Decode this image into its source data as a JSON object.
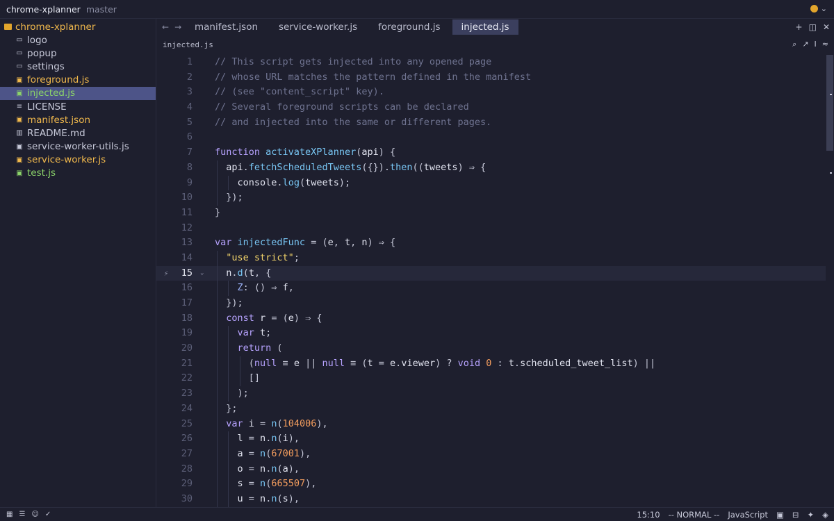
{
  "titlebar": {
    "project": "chrome-xplanner",
    "branch": "master"
  },
  "sidebar": {
    "root": "chrome-xplanner",
    "items": [
      {
        "label": "logo",
        "icon": "folder-icon",
        "glyph": "▭",
        "color": "#c6c8d8"
      },
      {
        "label": "popup",
        "icon": "folder-icon",
        "glyph": "▭",
        "color": "#c6c8d8"
      },
      {
        "label": "settings",
        "icon": "folder-icon",
        "glyph": "▭",
        "color": "#c6c8d8"
      },
      {
        "label": "foreground.js",
        "icon": "js-file-icon",
        "glyph": "▣",
        "color": "#f0b84c"
      },
      {
        "label": "injected.js",
        "icon": "js-file-icon",
        "glyph": "▣",
        "color": "#8bd36a",
        "active": true
      },
      {
        "label": "LICENSE",
        "icon": "text-file-icon",
        "glyph": "≡",
        "color": "#c6c8d8"
      },
      {
        "label": "manifest.json",
        "icon": "json-file-icon",
        "glyph": "▣",
        "color": "#f0b84c"
      },
      {
        "label": "README.md",
        "icon": "markdown-file-icon",
        "glyph": "▥",
        "color": "#c6c8d8"
      },
      {
        "label": "service-worker-utils.js",
        "icon": "js-file-icon",
        "glyph": "▣",
        "color": "#c6c8d8"
      },
      {
        "label": "service-worker.js",
        "icon": "js-file-icon",
        "glyph": "▣",
        "color": "#f0b84c"
      },
      {
        "label": "test.js",
        "icon": "js-file-icon",
        "glyph": "▣",
        "color": "#8bd36a"
      }
    ]
  },
  "tabs": [
    {
      "label": "manifest.json",
      "active": false
    },
    {
      "label": "service-worker.js",
      "active": false
    },
    {
      "label": "foreground.js",
      "active": false
    },
    {
      "label": "injected.js",
      "active": true
    }
  ],
  "breadcrumb": "injected.js",
  "editor": {
    "current_line": 15,
    "lines": [
      [
        [
          "// This script gets injected into any opened page",
          "com"
        ]
      ],
      [
        [
          "// whose URL matches the pattern defined in the manifest",
          "com"
        ]
      ],
      [
        [
          "// (see \"content_script\" key).",
          "com"
        ]
      ],
      [
        [
          "// Several foreground scripts can be declared",
          "com"
        ]
      ],
      [
        [
          "// and injected into the same or different pages.",
          "com"
        ]
      ],
      [],
      [
        [
          "function ",
          "kw"
        ],
        [
          "activateXPlanner",
          "fn"
        ],
        [
          "(",
          "pun"
        ],
        [
          "api",
          "var"
        ],
        [
          ") {",
          "pun"
        ]
      ],
      [
        [
          "  ",
          "pun"
        ],
        [
          "api",
          "var"
        ],
        [
          ".",
          "pun"
        ],
        [
          "fetchScheduledTweets",
          "fn"
        ],
        [
          "({}).",
          "pun"
        ],
        [
          "then",
          "fn"
        ],
        [
          "((",
          "pun"
        ],
        [
          "tweets",
          "var"
        ],
        [
          ") ⇒ {",
          "pun"
        ]
      ],
      [
        [
          "    ",
          "pun"
        ],
        [
          "console",
          "var"
        ],
        [
          ".",
          "pun"
        ],
        [
          "log",
          "fn"
        ],
        [
          "(",
          "pun"
        ],
        [
          "tweets",
          "var"
        ],
        [
          ");",
          "pun"
        ]
      ],
      [
        [
          "  });",
          "pun"
        ]
      ],
      [
        [
          "}",
          "pun"
        ]
      ],
      [],
      [
        [
          "var ",
          "kw"
        ],
        [
          "injectedFunc",
          "fn"
        ],
        [
          " = (",
          "pun"
        ],
        [
          "e",
          "var"
        ],
        [
          ", ",
          "pun"
        ],
        [
          "t",
          "var"
        ],
        [
          ", ",
          "pun"
        ],
        [
          "n",
          "var"
        ],
        [
          ") ⇒ {",
          "pun"
        ]
      ],
      [
        [
          "  ",
          "pun"
        ],
        [
          "\"use strict\"",
          "str"
        ],
        [
          ";",
          "pun"
        ]
      ],
      [
        [
          "  ",
          "pun"
        ],
        [
          "n",
          "var"
        ],
        [
          ".",
          "pun"
        ],
        [
          "d",
          "fn"
        ],
        [
          "(",
          "pun"
        ],
        [
          "t",
          "var"
        ],
        [
          ", {",
          "pun"
        ]
      ],
      [
        [
          "    ",
          "pun"
        ],
        [
          "Z",
          "prop"
        ],
        [
          ": () ⇒ ",
          "pun"
        ],
        [
          "f",
          "var"
        ],
        [
          ",",
          "pun"
        ]
      ],
      [
        [
          "  });",
          "pun"
        ]
      ],
      [
        [
          "  ",
          "pun"
        ],
        [
          "const ",
          "kw"
        ],
        [
          "r",
          "var"
        ],
        [
          " = (",
          "pun"
        ],
        [
          "e",
          "var"
        ],
        [
          ") ⇒ {",
          "pun"
        ]
      ],
      [
        [
          "    ",
          "pun"
        ],
        [
          "var ",
          "kw"
        ],
        [
          "t",
          "var"
        ],
        [
          ";",
          "pun"
        ]
      ],
      [
        [
          "    ",
          "pun"
        ],
        [
          "return ",
          "kw"
        ],
        [
          "(",
          "pun"
        ]
      ],
      [
        [
          "      (",
          "pun"
        ],
        [
          "null",
          "kw"
        ],
        [
          " ≡ ",
          "pun"
        ],
        [
          "e",
          "var"
        ],
        [
          " || ",
          "pun"
        ],
        [
          "null",
          "kw"
        ],
        [
          " ≡ (",
          "pun"
        ],
        [
          "t",
          "var"
        ],
        [
          " = ",
          "pun"
        ],
        [
          "e",
          "var"
        ],
        [
          ".",
          "pun"
        ],
        [
          "viewer",
          "var"
        ],
        [
          ") ? ",
          "pun"
        ],
        [
          "void ",
          "kw"
        ],
        [
          "0",
          "num"
        ],
        [
          " : ",
          "pun"
        ],
        [
          "t",
          "var"
        ],
        [
          ".",
          "pun"
        ],
        [
          "scheduled_tweet_list",
          "var"
        ],
        [
          ") ||",
          "pun"
        ]
      ],
      [
        [
          "      []",
          "pun"
        ]
      ],
      [
        [
          "    );",
          "pun"
        ]
      ],
      [
        [
          "  };",
          "pun"
        ]
      ],
      [
        [
          "  ",
          "pun"
        ],
        [
          "var ",
          "kw"
        ],
        [
          "i",
          "var"
        ],
        [
          " = ",
          "pun"
        ],
        [
          "n",
          "fn"
        ],
        [
          "(",
          "pun"
        ],
        [
          "104006",
          "num"
        ],
        [
          "),",
          "pun"
        ]
      ],
      [
        [
          "    ",
          "pun"
        ],
        [
          "l",
          "var"
        ],
        [
          " = ",
          "pun"
        ],
        [
          "n",
          "var"
        ],
        [
          ".",
          "pun"
        ],
        [
          "n",
          "fn"
        ],
        [
          "(",
          "pun"
        ],
        [
          "i",
          "var"
        ],
        [
          "),",
          "pun"
        ]
      ],
      [
        [
          "    ",
          "pun"
        ],
        [
          "a",
          "var"
        ],
        [
          " = ",
          "pun"
        ],
        [
          "n",
          "fn"
        ],
        [
          "(",
          "pun"
        ],
        [
          "67001",
          "num"
        ],
        [
          "),",
          "pun"
        ]
      ],
      [
        [
          "    ",
          "pun"
        ],
        [
          "o",
          "var"
        ],
        [
          " = ",
          "pun"
        ],
        [
          "n",
          "var"
        ],
        [
          ".",
          "pun"
        ],
        [
          "n",
          "fn"
        ],
        [
          "(",
          "pun"
        ],
        [
          "a",
          "var"
        ],
        [
          "),",
          "pun"
        ]
      ],
      [
        [
          "    ",
          "pun"
        ],
        [
          "s",
          "var"
        ],
        [
          " = ",
          "pun"
        ],
        [
          "n",
          "fn"
        ],
        [
          "(",
          "pun"
        ],
        [
          "665507",
          "num"
        ],
        [
          "),",
          "pun"
        ]
      ],
      [
        [
          "    ",
          "pun"
        ],
        [
          "u",
          "var"
        ],
        [
          " = ",
          "pun"
        ],
        [
          "n",
          "var"
        ],
        [
          ".",
          "pun"
        ],
        [
          "n",
          "fn"
        ],
        [
          "(",
          "pun"
        ],
        [
          "s",
          "var"
        ],
        [
          "),",
          "pun"
        ]
      ]
    ]
  },
  "statusbar": {
    "position": "15:10",
    "mode": "-- NORMAL --",
    "language": "JavaScript"
  },
  "colors": {
    "background": "#1e1f2e",
    "active_item": "#4d5488",
    "active_tab": "#3b3f5e",
    "keyword": "#b7a3ff",
    "function": "#79c7f5",
    "string": "#f3d46a",
    "number": "#f39d5e",
    "comment": "#6f7390"
  }
}
